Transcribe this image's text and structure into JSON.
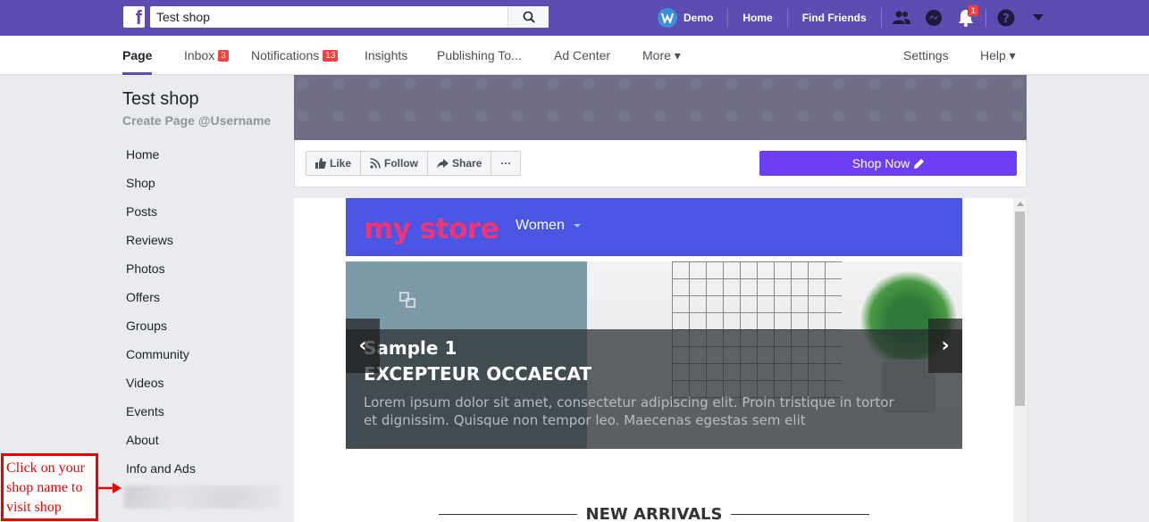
{
  "topbar": {
    "search_value": "Test shop",
    "user": "Demo",
    "home": "Home",
    "find_friends": "Find Friends",
    "notif_count": "1"
  },
  "pagenav": {
    "items": [
      {
        "label": "Page"
      },
      {
        "label": "Inbox",
        "count": "3"
      },
      {
        "label": "Notifications",
        "count": "13"
      },
      {
        "label": "Insights"
      },
      {
        "label": "Publishing To..."
      },
      {
        "label": "Ad Center"
      },
      {
        "label": "More ▾"
      },
      {
        "label": "Settings"
      },
      {
        "label": "Help ▾"
      }
    ]
  },
  "sidebar": {
    "title": "Test shop",
    "username": "Create Page @Username",
    "items": [
      "Home",
      "Shop",
      "Posts",
      "Reviews",
      "Photos",
      "Offers",
      "Groups",
      "Community",
      "Videos",
      "Events",
      "About",
      "Info and Ads"
    ]
  },
  "annotation": {
    "text": "Click on your shop name to visit shop"
  },
  "actions": {
    "like": "Like",
    "follow": "Follow",
    "share": "Share",
    "more": "···",
    "shop_now": "Shop Now"
  },
  "store": {
    "logo": "my store",
    "menu": "Women",
    "slide_title": "Sample 1",
    "slide_subtitle": "EXCEPTEUR OCCAECAT",
    "slide_text": "Lorem ipsum dolor sit amet, consectetur adipiscing elit. Proin tristique in tortor et dignissim. Quisque non tempor leo. Maecenas egestas sem elit",
    "section_title": "NEW ARRIVALS",
    "prev": "‹",
    "next": "›"
  },
  "colors": {
    "topbar": "#5b4db1",
    "shop_now": "#6e3ef2",
    "store_header": "#4a55e4",
    "annotation": "#ee0000"
  }
}
